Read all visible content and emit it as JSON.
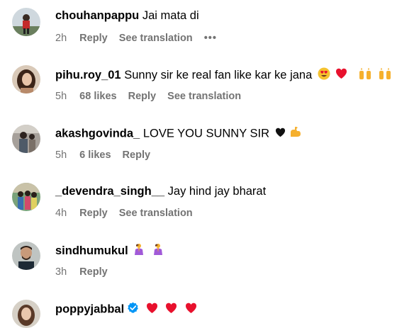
{
  "comments": [
    {
      "username": "chouhanpappu",
      "text": "Jai mata di",
      "time": "2h",
      "likes": "",
      "reply": "Reply",
      "translate": "See translation",
      "more": "•••",
      "emojis": []
    },
    {
      "username": "pihu.roy_01",
      "text": "Sunny sir ke real fan like kar ke jana",
      "time": "5h",
      "likes": "68 likes",
      "reply": "Reply",
      "translate": "See translation",
      "emojis": [
        "heart-eyes-emoji",
        "red-heart-emoji",
        "raising-hands-emoji",
        "raising-hands-emoji"
      ]
    },
    {
      "username": "akashgovinda_",
      "text": "LOVE YOU SUNNY SIR",
      "time": "5h",
      "likes": "6 likes",
      "reply": "Reply",
      "emojis": [
        "black-heart-emoji",
        "flexed-biceps-emoji"
      ]
    },
    {
      "username": "_devendra_singh__",
      "text": "Jay hind jay bharat",
      "time": "4h",
      "reply": "Reply",
      "translate": "See translation",
      "emojis": []
    },
    {
      "username": "sindhumukul",
      "text": "",
      "time": "3h",
      "reply": "Reply",
      "emojis": [
        "person-praying-emoji",
        "person-praying-emoji"
      ]
    },
    {
      "username": "poppyjabbal",
      "text": "",
      "verified": true,
      "emojis": [
        "red-heart-emoji",
        "red-heart-emoji",
        "red-heart-emoji"
      ]
    }
  ],
  "colors": {
    "meta_gray": "#737373",
    "verified_blue": "#0095f6",
    "heart_red": "#e8112d"
  }
}
